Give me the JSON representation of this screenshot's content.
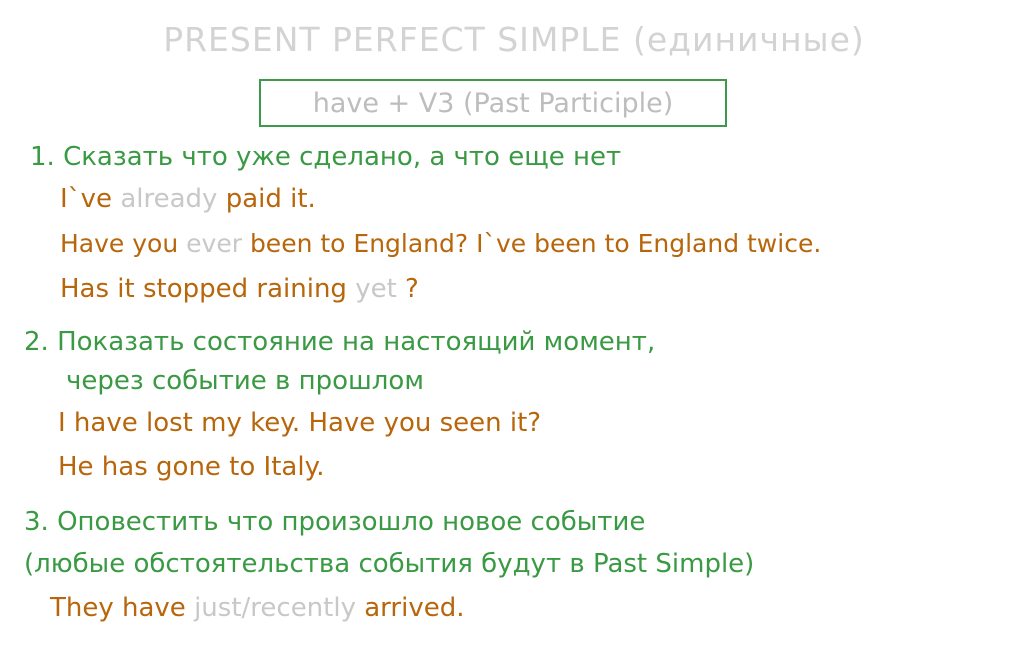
{
  "title": "PRESENT PERFECT SIMPLE (единичные)",
  "formula": "have + V3 (Past Participle)",
  "sections": [
    {
      "heading": "1. Сказать что уже сделано, а что еще нет",
      "examples": [
        {
          "before": "I`ve",
          "hint": "already",
          "after": "paid it."
        },
        {
          "before": "Have you",
          "hint": "ever",
          "after": "been to England? I`ve been to England twice."
        },
        {
          "before": "Has it stopped raining",
          "hint": "yet",
          "after": "?"
        }
      ]
    },
    {
      "heading_line1": "2. Показать состояние на настоящий момент,",
      "heading_line2": "через событие в прошлом",
      "examples": [
        {
          "text": "I have lost my key.  Have you seen it?"
        },
        {
          "text": "He has gone to Italy."
        }
      ]
    },
    {
      "heading_line1": "3. Оповестить что произошло новое событие",
      "heading_line2": "(любые обстоятельства события будут в Past Simple)",
      "examples": [
        {
          "before": "They have",
          "hint": "just/recently",
          "after": "arrived."
        }
      ]
    }
  ],
  "colors": {
    "heading_green": "#3a9a44",
    "example_orange": "#b8660c",
    "hint_grey": "#c8c8c8",
    "title_grey": "#d3d3d3",
    "box_border": "#3d9a4b"
  }
}
